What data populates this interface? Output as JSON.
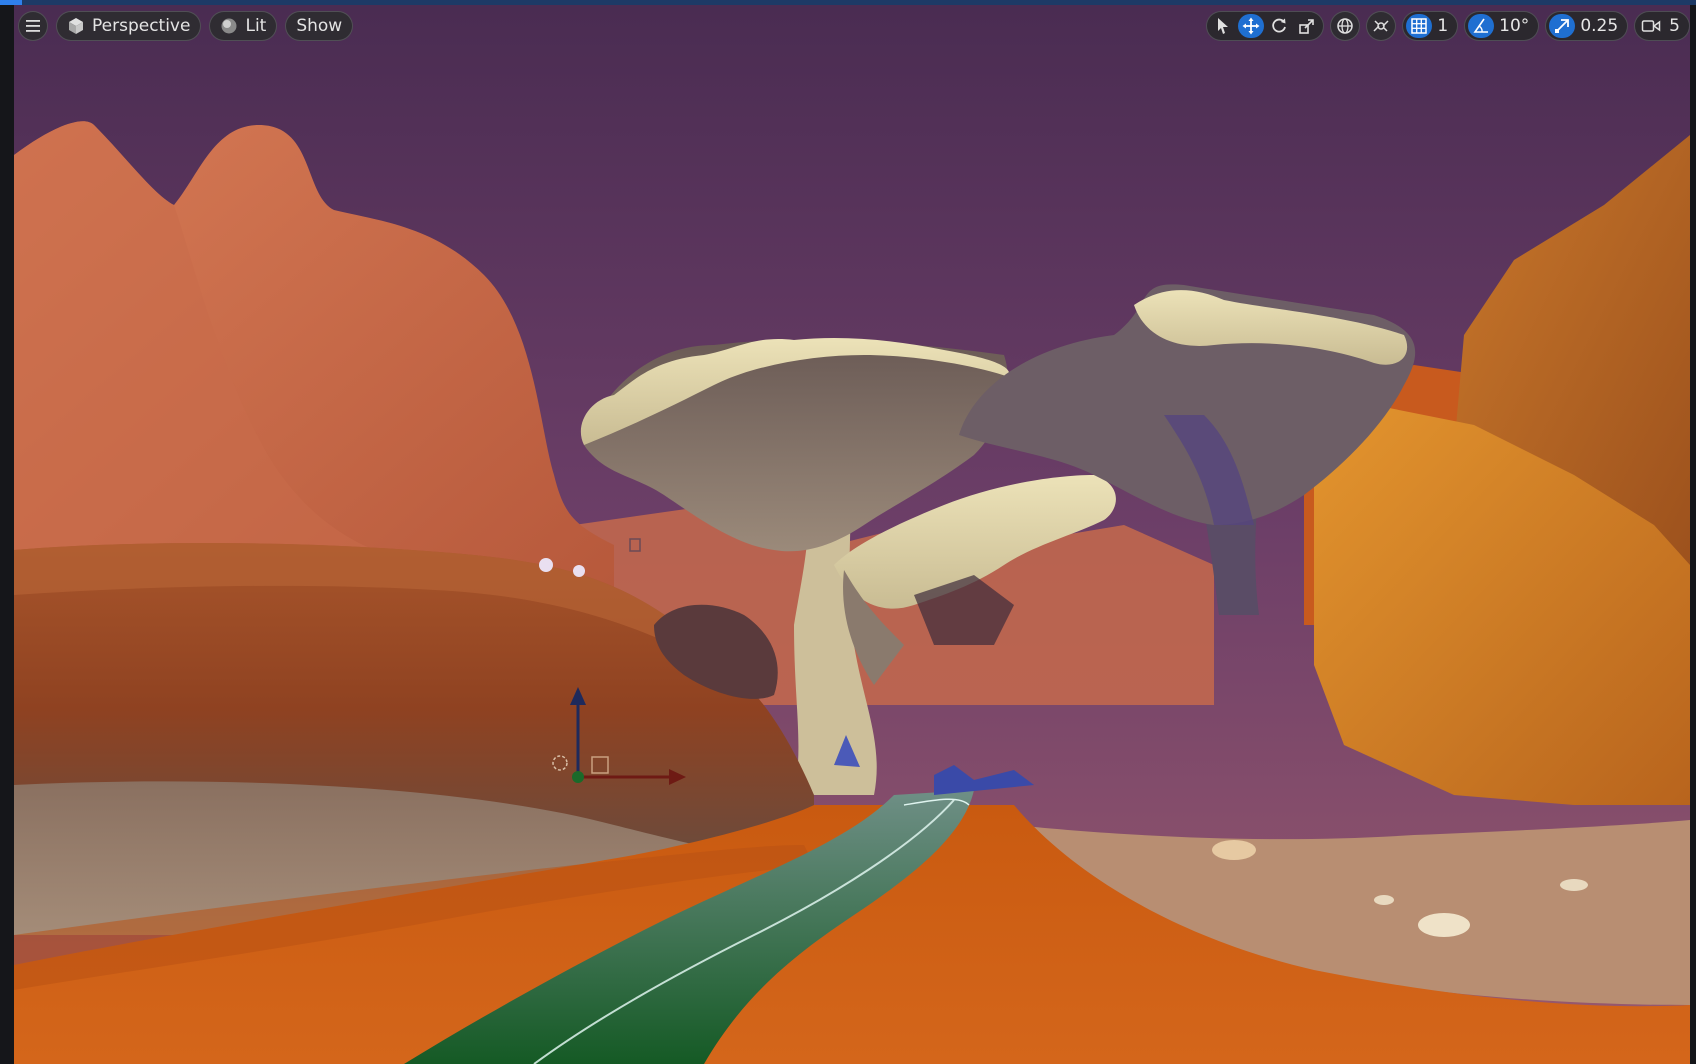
{
  "toolbar_left": {
    "menu_icon": "hamburger-menu-icon",
    "perspective_label": "Perspective",
    "lit_label": "Lit",
    "show_label": "Show"
  },
  "toolbar_right": {
    "grid_snap_value": "1",
    "rotation_snap_value": "10°",
    "scale_snap_value": "0.25",
    "camera_speed_value": "5"
  },
  "colors": {
    "accent": "#1f6fd1",
    "sky_top": "#4e2d55",
    "sand": "#c85a14",
    "river": "#1f6b2c"
  }
}
